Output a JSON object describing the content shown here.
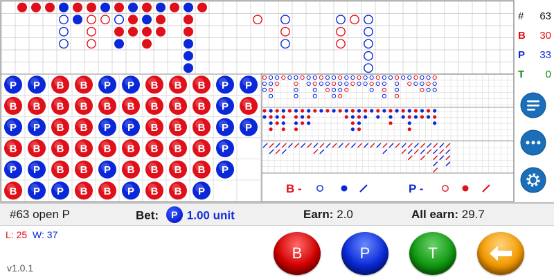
{
  "stats": {
    "total_label": "#",
    "total": "63",
    "b_label": "B",
    "b": "30",
    "p_label": "P",
    "p": "33",
    "t_label": "T",
    "t": "0"
  },
  "bead_plate": [
    [
      "P",
      "B",
      "P",
      "B",
      "P",
      "B"
    ],
    [
      "P",
      "B",
      "P",
      "B",
      "P",
      "P"
    ],
    [
      "B",
      "B",
      "B",
      "B",
      "B",
      "P"
    ],
    [
      "B",
      "B",
      "B",
      "B",
      "B",
      "B"
    ],
    [
      "P",
      "B",
      "P",
      "B",
      "P",
      "B"
    ],
    [
      "P",
      "B",
      "P",
      "B",
      "B",
      "P"
    ],
    [
      "B",
      "B",
      "B",
      "B",
      "B",
      "B"
    ],
    [
      "B",
      "B",
      "B",
      "B",
      "B",
      "B"
    ],
    [
      "B",
      "B",
      "B",
      "B",
      "B",
      "P"
    ],
    [
      "P",
      "P",
      "P",
      "P",
      "P",
      ""
    ],
    [
      "P",
      "B",
      "P",
      "",
      "",
      ""
    ]
  ],
  "big_road": [
    [],
    [
      {
        "t": "filled",
        "c": "R"
      }
    ],
    [
      {
        "t": "filled",
        "c": "R"
      }
    ],
    [
      {
        "t": "filled",
        "c": "R"
      }
    ],
    [
      {
        "t": "filled",
        "c": "B"
      }
    ],
    [
      {
        "t": "filled",
        "c": "R"
      },
      {
        "t": "filled",
        "c": "B"
      }
    ],
    [
      {
        "t": "filled",
        "c": "R"
      }
    ],
    [
      {
        "t": "filled",
        "c": "B"
      }
    ],
    [
      {
        "t": "filled",
        "c": "R"
      },
      {
        "t": "filled",
        "c": "B"
      },
      {
        "t": "filled",
        "c": "R"
      },
      {
        "t": "filled",
        "c": "B"
      }
    ],
    [
      {
        "t": "filled",
        "c": "B"
      },
      {
        "t": "filled",
        "c": "R"
      },
      {
        "t": "filled",
        "c": "R"
      }
    ],
    [
      {
        "t": "filled",
        "c": "R"
      },
      {
        "t": "filled",
        "c": "B"
      },
      {
        "t": "filled",
        "c": "R"
      },
      {
        "t": "filled",
        "c": "R"
      }
    ],
    [
      {
        "t": "filled",
        "c": "B"
      },
      {
        "t": "filled",
        "c": "R"
      },
      {
        "t": "filled",
        "c": "R"
      }
    ],
    [
      {
        "t": "filled",
        "c": "R"
      }
    ],
    [
      {
        "t": "filled",
        "c": "B"
      },
      {
        "t": "filled",
        "c": "R"
      },
      {
        "t": "filled",
        "c": "R"
      },
      {
        "t": "filled",
        "c": "B"
      },
      {
        "t": "filled",
        "c": "B"
      },
      {
        "t": "filled",
        "c": "B"
      }
    ],
    [
      {
        "t": "filled",
        "c": "R"
      }
    ],
    []
  ],
  "big_road_hollow": [
    [],
    [],
    [],
    [],
    [
      {
        "c": "B"
      },
      {
        "c": "B"
      },
      {
        "c": "B"
      }
    ],
    [],
    [
      {
        "c": "R"
      },
      {
        "c": "R"
      },
      {
        "c": "R"
      }
    ],
    [
      {
        "c": "R"
      }
    ],
    [
      {
        "c": "B"
      }
    ],
    [],
    [],
    [],
    [],
    [],
    [],
    [],
    [],
    [],
    [
      {
        "c": "R"
      }
    ],
    [],
    [
      {
        "c": "B"
      },
      {
        "c": "R"
      },
      {
        "c": "B"
      }
    ],
    [],
    [],
    [],
    [
      {
        "c": "B"
      },
      {
        "c": "R"
      },
      {
        "c": "R"
      }
    ],
    [
      {
        "c": "R"
      }
    ],
    [
      {
        "c": "B"
      },
      {
        "c": "B"
      },
      {
        "c": "B"
      },
      {
        "c": "B"
      },
      {
        "c": "B"
      }
    ]
  ],
  "legend": {
    "b_label": "B -",
    "p_label": "P -"
  },
  "info": {
    "round": "#63 open P",
    "bet_label": "Bet:",
    "bet_chip": "P",
    "bet_value": "1.00 unit",
    "earn_label": "Earn:",
    "earn_value": "2.0",
    "all_earn_label": "All earn:",
    "all_earn_value": "29.7"
  },
  "record": {
    "l_label": "L:",
    "l_value": "25",
    "w_label": "W:",
    "w_value": "37"
  },
  "version": "v1.0.1",
  "buttons": {
    "b": "B",
    "p": "P",
    "t": "T"
  },
  "colors": {
    "banker": "#e0101a",
    "player": "#0a28d8",
    "tie": "#138a13",
    "accent": "#1a6fb8"
  }
}
